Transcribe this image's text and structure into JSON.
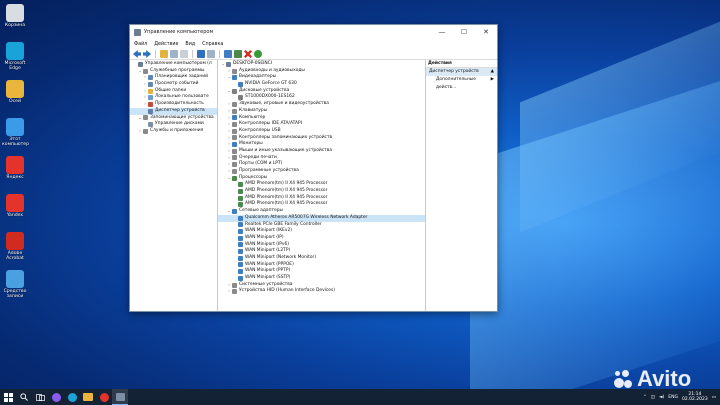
{
  "desktop": {
    "icons": [
      {
        "label": "Корзина",
        "color": "#d8dde4",
        "icon": "recycle-bin-icon"
      },
      {
        "label": "Microsoft Edge",
        "color": "#1aa3d9",
        "icon": "edge-icon"
      },
      {
        "label": "Осей",
        "color": "#e9b53c",
        "icon": "folder-icon"
      },
      {
        "label": "Этот компьютер",
        "color": "#3a9be8",
        "icon": "computer-icon"
      },
      {
        "label": "Яндекс",
        "color": "#e4332a",
        "icon": "yandex-icon"
      },
      {
        "label": "Yandex",
        "color": "#e4332a",
        "icon": "yandex-browser-icon"
      },
      {
        "label": "Adobe Acrobat",
        "color": "#d12a1f",
        "icon": "acrobat-icon"
      },
      {
        "label": "Средство записи",
        "color": "#4aa0e0",
        "icon": "tool-icon"
      }
    ]
  },
  "window": {
    "title": "Управление компьютером",
    "controls": {
      "minimize": "—",
      "maximize": "☐",
      "close": "✕"
    },
    "menu": [
      "Файл",
      "Действие",
      "Вид",
      "Справка"
    ]
  },
  "left_tree": [
    {
      "label": "Управление компьютером (л",
      "level": 0,
      "exp": "",
      "color": "#6b7c93"
    },
    {
      "label": "Служебные программы",
      "level": 1,
      "exp": "⌄",
      "color": "#8a8a8a"
    },
    {
      "label": "Планировщик заданий",
      "level": 2,
      "exp": "›",
      "color": "#5f8ab8"
    },
    {
      "label": "Просмотр событий",
      "level": 2,
      "exp": "›",
      "color": "#5f8ab8"
    },
    {
      "label": "Общие папки",
      "level": 2,
      "exp": "›",
      "color": "#e3b341"
    },
    {
      "label": "Локальные пользовате",
      "level": 2,
      "exp": "›",
      "color": "#6e9bd0"
    },
    {
      "label": "Производительность",
      "level": 2,
      "exp": "›",
      "color": "#c84a3c"
    },
    {
      "label": "Диспетчер устройств",
      "level": 2,
      "exp": "",
      "color": "#5f7fa8",
      "selected": true
    },
    {
      "label": "Запоминающие устройства",
      "level": 1,
      "exp": "⌄",
      "color": "#8a8a8a"
    },
    {
      "label": "Управление дисками",
      "level": 2,
      "exp": "",
      "color": "#7d8fa5"
    },
    {
      "label": "Службы и приложения",
      "level": 1,
      "exp": "›",
      "color": "#8a8a8a"
    }
  ],
  "device_tree": [
    {
      "label": "DESKTOP-0SEINCI",
      "level": 0,
      "exp": "⌄",
      "color": "#6b7c93"
    },
    {
      "label": "Аудиовходы и аудиовыходы",
      "level": 1,
      "exp": "›",
      "color": "#8a8a8a"
    },
    {
      "label": "Видеоадаптеры",
      "level": 1,
      "exp": "⌄",
      "color": "#3f7ec0"
    },
    {
      "label": "NVIDIA GeForce GT 630",
      "level": 2,
      "exp": "",
      "color": "#3f7ec0"
    },
    {
      "label": "Дисковые устройства",
      "level": 1,
      "exp": "⌄",
      "color": "#7d7d7d"
    },
    {
      "label": "ST1000DX000-1ES162",
      "level": 2,
      "exp": "",
      "color": "#7d7d7d"
    },
    {
      "label": "Звуковые, игровые и видеоустройства",
      "level": 1,
      "exp": "›",
      "color": "#8a8a8a"
    },
    {
      "label": "Клавиатуры",
      "level": 1,
      "exp": "›",
      "color": "#8a8a8a"
    },
    {
      "label": "Компьютер",
      "level": 1,
      "exp": "›",
      "color": "#3f7ec0"
    },
    {
      "label": "Контроллеры IDE ATA/ATAPI",
      "level": 1,
      "exp": "›",
      "color": "#8a8a8a"
    },
    {
      "label": "Контроллеры USB",
      "level": 1,
      "exp": "›",
      "color": "#8a8a8a"
    },
    {
      "label": "Контроллеры запоминающих устройств",
      "level": 1,
      "exp": "›",
      "color": "#8a8a8a"
    },
    {
      "label": "Мониторы",
      "level": 1,
      "exp": "›",
      "color": "#3f7ec0"
    },
    {
      "label": "Мыши и иные указывающие устройства",
      "level": 1,
      "exp": "›",
      "color": "#8a8a8a"
    },
    {
      "label": "Очереди печати",
      "level": 1,
      "exp": "›",
      "color": "#8a8a8a"
    },
    {
      "label": "Порты (COM и LPT)",
      "level": 1,
      "exp": "›",
      "color": "#8a8a8a"
    },
    {
      "label": "Программные устройства",
      "level": 1,
      "exp": "›",
      "color": "#8a8a8a"
    },
    {
      "label": "Процессоры",
      "level": 1,
      "exp": "⌄",
      "color": "#4b8a4b"
    },
    {
      "label": "AMD Phenom(tm) II X4 945 Processor",
      "level": 2,
      "exp": "",
      "color": "#4b8a4b"
    },
    {
      "label": "AMD Phenom(tm) II X4 945 Processor",
      "level": 2,
      "exp": "",
      "color": "#4b8a4b"
    },
    {
      "label": "AMD Phenom(tm) II X4 945 Processor",
      "level": 2,
      "exp": "",
      "color": "#4b8a4b"
    },
    {
      "label": "AMD Phenom(tm) II X4 945 Processor",
      "level": 2,
      "exp": "",
      "color": "#4b8a4b"
    },
    {
      "label": "Сетевые адаптеры",
      "level": 1,
      "exp": "⌄",
      "color": "#3f7ec0"
    },
    {
      "label": "Qualcomm Atheros AR5007G Wireless Network Adapter",
      "level": 2,
      "exp": "",
      "color": "#3f7ec0",
      "selected": true
    },
    {
      "label": "Realtek PCIe GBE Family Controller",
      "level": 2,
      "exp": "",
      "color": "#3f7ec0"
    },
    {
      "label": "WAN Miniport (IKEv2)",
      "level": 2,
      "exp": "",
      "color": "#3f7ec0"
    },
    {
      "label": "WAN Miniport (IP)",
      "level": 2,
      "exp": "",
      "color": "#3f7ec0"
    },
    {
      "label": "WAN Miniport (IPv6)",
      "level": 2,
      "exp": "",
      "color": "#3f7ec0"
    },
    {
      "label": "WAN Miniport (L2TP)",
      "level": 2,
      "exp": "",
      "color": "#3f7ec0"
    },
    {
      "label": "WAN Miniport (Network Monitor)",
      "level": 2,
      "exp": "",
      "color": "#3f7ec0"
    },
    {
      "label": "WAN Miniport (PPPOE)",
      "level": 2,
      "exp": "",
      "color": "#3f7ec0"
    },
    {
      "label": "WAN Miniport (PPTP)",
      "level": 2,
      "exp": "",
      "color": "#3f7ec0"
    },
    {
      "label": "WAN Miniport (SSTP)",
      "level": 2,
      "exp": "",
      "color": "#3f7ec0"
    },
    {
      "label": "Системные устройства",
      "level": 1,
      "exp": "›",
      "color": "#8a8a8a"
    },
    {
      "label": "Устройства HID (Human Interface Devices)",
      "level": 1,
      "exp": "›",
      "color": "#8a8a8a"
    }
  ],
  "actions_pane": {
    "header": "Действия",
    "section": "Диспетчер устройств",
    "section_arrow": "▲",
    "more": "Дополнительные действ...",
    "more_arrow": "▶"
  },
  "taskbar": {
    "tray_lang": "ENG",
    "time": "21:14",
    "date": "02.02.2023"
  },
  "watermark": "Avito"
}
